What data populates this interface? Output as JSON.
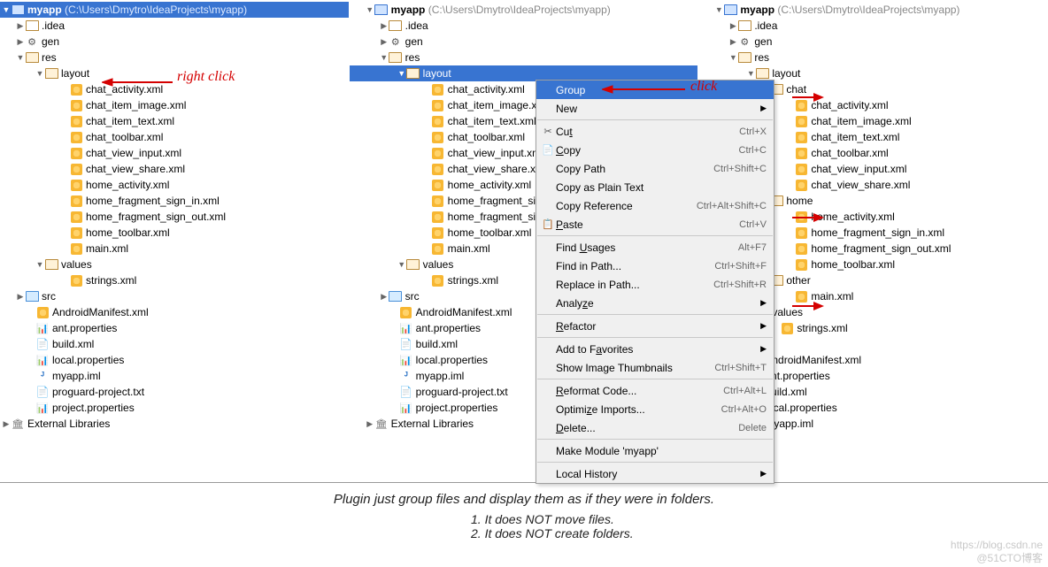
{
  "project": {
    "name": "myapp",
    "crumb": "(C:\\Users\\Dmytro\\IdeaProjects\\myapp)"
  },
  "tree_common": {
    "idea": ".idea",
    "gen": "gen",
    "res": "res",
    "layout": "layout",
    "values": "values",
    "src": "src",
    "ext": "External Libraries",
    "strings": "strings.xml",
    "manifest": "AndroidManifest.xml",
    "ant": "ant.properties",
    "build": "build.xml",
    "local": "local.properties",
    "iml": "myapp.iml",
    "proguard": "proguard-project.txt",
    "projprop": "project.properties"
  },
  "layout_files": [
    "chat_activity.xml",
    "chat_item_image.xml",
    "chat_item_text.xml",
    "chat_toolbar.xml",
    "chat_view_input.xml",
    "chat_view_share.xml",
    "home_activity.xml",
    "home_fragment_sign_in.xml",
    "home_fragment_sign_out.xml",
    "home_toolbar.xml",
    "main.xml"
  ],
  "grouped": {
    "chat": {
      "name": "chat",
      "files": [
        "chat_activity.xml",
        "chat_item_image.xml",
        "chat_item_text.xml",
        "chat_toolbar.xml",
        "chat_view_input.xml",
        "chat_view_share.xml"
      ]
    },
    "home": {
      "name": "home",
      "files": [
        "home_activity.xml",
        "home_fragment_sign_in.xml",
        "home_fragment_sign_out.xml",
        "home_toolbar.xml"
      ]
    },
    "other": {
      "name": "other",
      "files": [
        "main.xml"
      ]
    }
  },
  "annot": {
    "right_click": "right click",
    "click": "click"
  },
  "menu": {
    "group": "Group",
    "new": "New",
    "cut": "Cut",
    "cut_k": "Ctrl+X",
    "copy": "Copy",
    "copy_k": "Ctrl+C",
    "copypath": "Copy Path",
    "copypath_k": "Ctrl+Shift+C",
    "copyplain": "Copy as Plain Text",
    "copyref": "Copy Reference",
    "copyref_k": "Ctrl+Alt+Shift+C",
    "paste": "Paste",
    "paste_k": "Ctrl+V",
    "findu": "Find Usages",
    "findu_k": "Alt+F7",
    "findp": "Find in Path...",
    "findp_k": "Ctrl+Shift+F",
    "replp": "Replace in Path...",
    "replp_k": "Ctrl+Shift+R",
    "analyze": "Analyze",
    "refactor": "Refactor",
    "fav": "Add to Favorites",
    "thumb": "Show Image Thumbnails",
    "thumb_k": "Ctrl+Shift+T",
    "reformat": "Reformat Code...",
    "reformat_k": "Ctrl+Alt+L",
    "optimize": "Optimize Imports...",
    "optimize_k": "Ctrl+Alt+O",
    "delete": "Delete...",
    "delete_k": "Delete",
    "make": "Make Module 'myapp'",
    "localhist": "Local History"
  },
  "caption": "Plugin just group files and display them as if they were in folders.",
  "caption_items": [
    "1. It does NOT move files.",
    "2. It does NOT create folders."
  ],
  "watermark1": "https://blog.csdn.ne",
  "watermark2": "@51CTO博客"
}
